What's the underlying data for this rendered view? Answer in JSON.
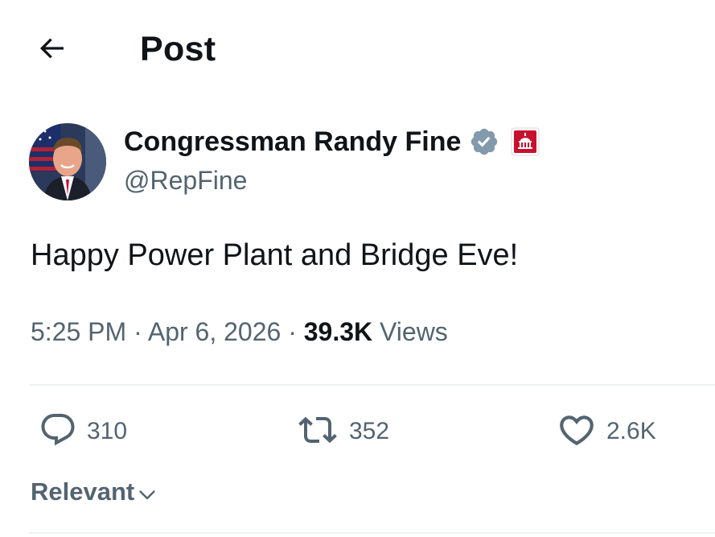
{
  "header": {
    "title": "Post",
    "back_icon": "arrow-left-icon"
  },
  "author": {
    "display_name": "Congressman Randy Fine",
    "handle": "@RepFine",
    "verified_icon": "verified-badge-icon",
    "verified_color": "#829aab",
    "affiliation_icon": "capitol-affiliation-badge-icon",
    "affiliation_color": "#c8102e"
  },
  "tweet": {
    "text": "Happy Power Plant and Bridge Eve!",
    "time": "5:25 PM",
    "separator": "·",
    "date": "Apr 6, 2026",
    "views_count": "39.3K",
    "views_label": "Views"
  },
  "actions": {
    "reply": {
      "icon": "reply-bubble-icon",
      "count": "310"
    },
    "repost": {
      "icon": "repost-icon",
      "count": "352"
    },
    "like": {
      "icon": "heart-icon",
      "count": "2.6K"
    }
  },
  "replies_sort": {
    "label": "Relevant",
    "icon": "chevron-down-icon"
  },
  "colors": {
    "text_primary": "#0f1419",
    "text_secondary": "#536471",
    "divider": "#eff3f4"
  }
}
